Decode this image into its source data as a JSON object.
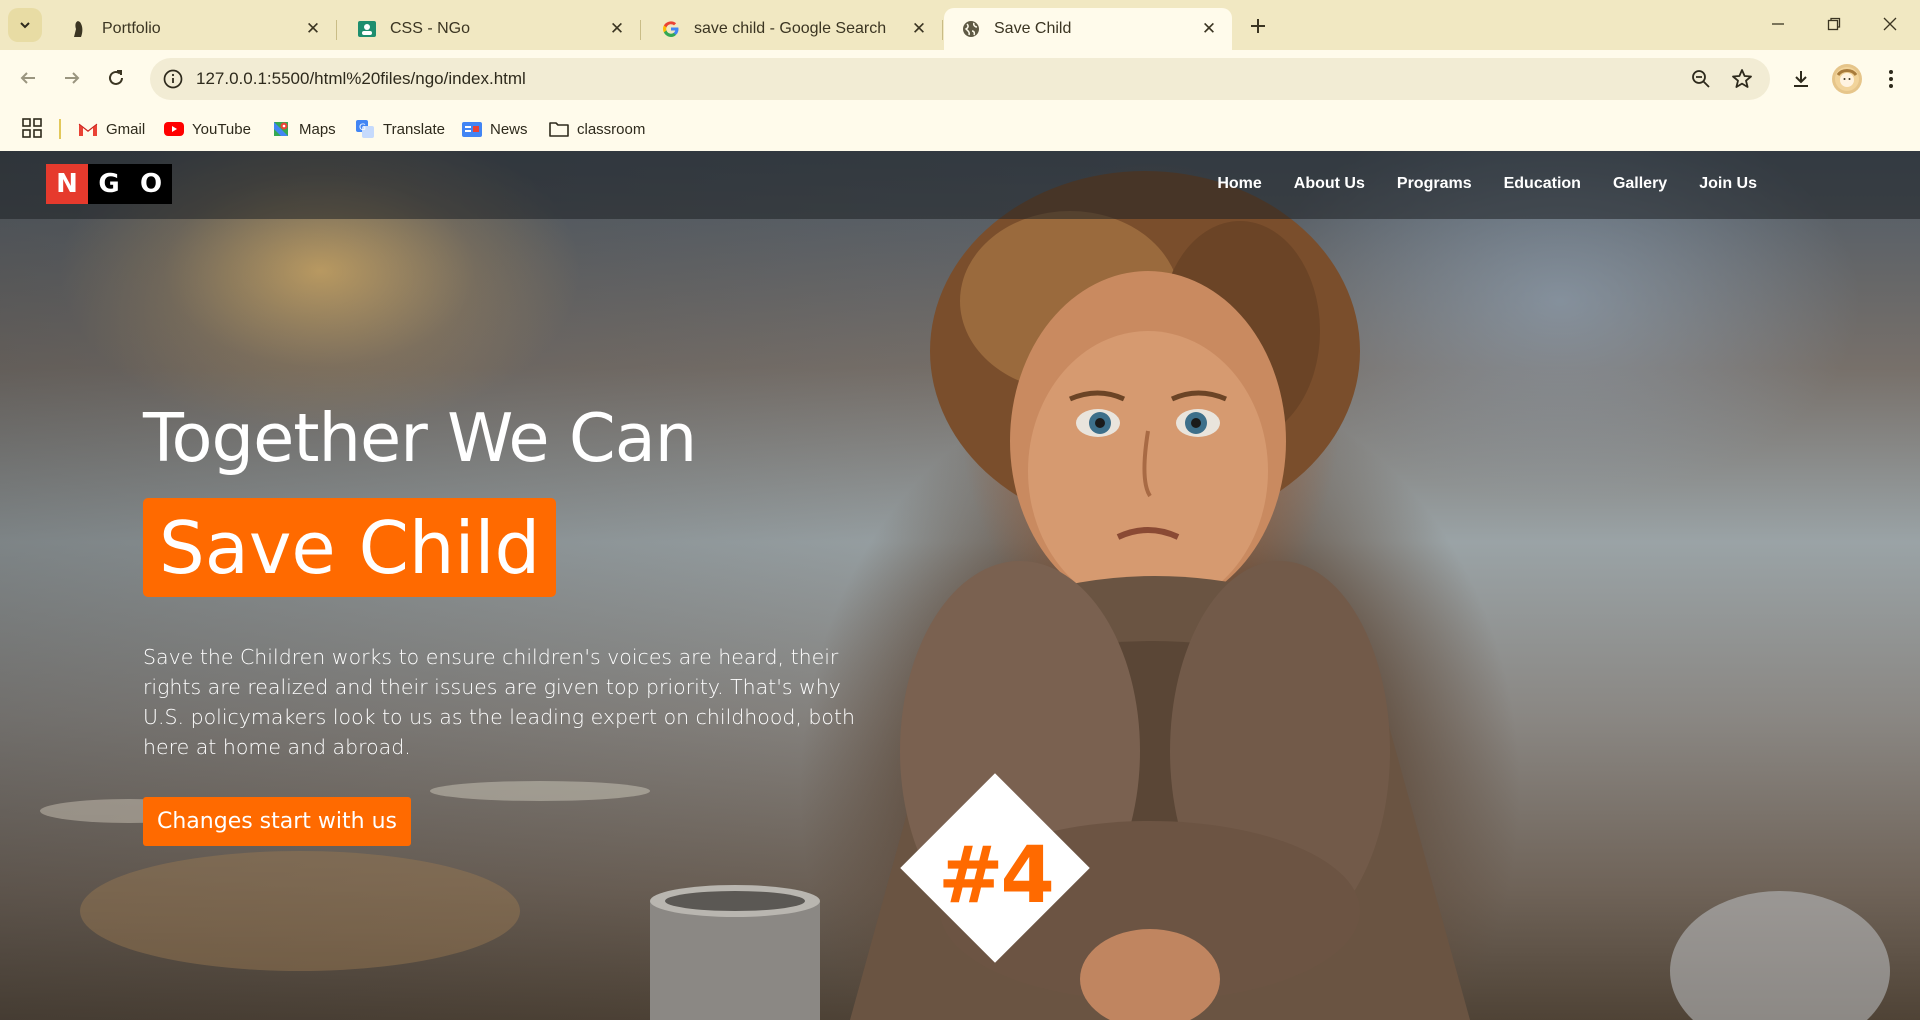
{
  "browser": {
    "tabs": [
      {
        "title": "Portfolio",
        "icon": "portfolio-favicon-icon"
      },
      {
        "title": "CSS - NGo",
        "icon": "classroom-favicon-icon"
      },
      {
        "title": "save child - Google Search",
        "icon": "google-favicon-icon"
      },
      {
        "title": "Save Child",
        "icon": "globe-icon",
        "active": true
      }
    ],
    "url": "127.0.0.1:5500/html%20files/ngo/index.html",
    "bookmarks": [
      {
        "label": "Gmail",
        "icon": "gmail-icon"
      },
      {
        "label": "YouTube",
        "icon": "youtube-icon"
      },
      {
        "label": "Maps",
        "icon": "maps-icon"
      },
      {
        "label": "Translate",
        "icon": "translate-icon"
      },
      {
        "label": "News",
        "icon": "news-icon"
      },
      {
        "label": "classroom",
        "icon": "folder-icon"
      }
    ],
    "theme_colors": {
      "tabstrip": "#f1e8c2",
      "toolbar": "#fffbeb"
    }
  },
  "site": {
    "logo_letters": [
      "N",
      "G",
      "O"
    ],
    "nav": [
      "Home",
      "About Us",
      "Programs",
      "Education",
      "Gallery",
      "Join Us"
    ],
    "hero": {
      "title": "Together We Can",
      "highlight": "Save Child",
      "description": "Save the Children works to ensure children's voices are heard, their rights are realized and their issues are given top priority. That's why U.S. policymakers look to us as the leading expert on childhood, both here at home and abroad.",
      "button": "Changes start with us",
      "badge": "#4"
    },
    "accent_color": "#ff6a00",
    "logo_accent_color": "#e63a2d"
  }
}
